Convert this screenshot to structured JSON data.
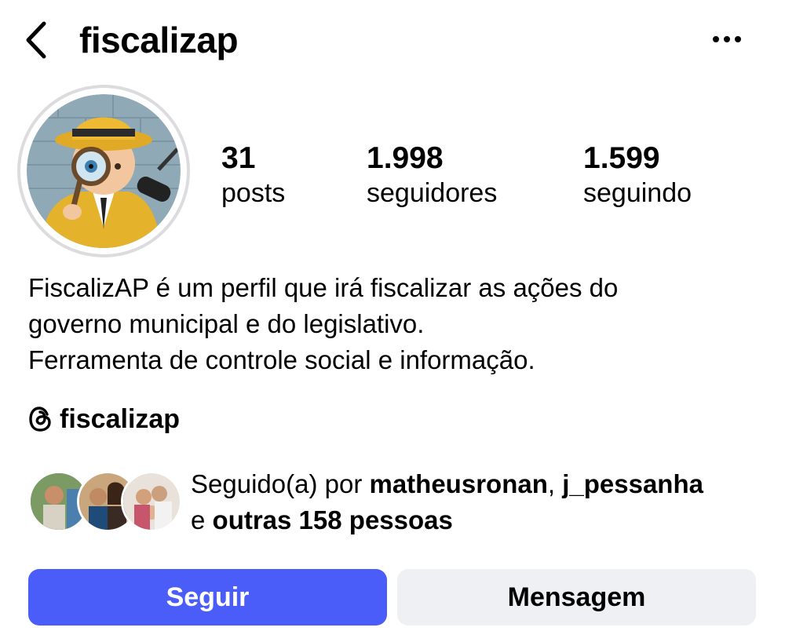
{
  "header": {
    "username": "fiscalizap",
    "back_icon": "chevron-left-icon",
    "more_icon": "more-horizontal-icon"
  },
  "stats": {
    "posts": {
      "value": "31",
      "label": "posts"
    },
    "followers": {
      "value": "1.998",
      "label": "seguidores"
    },
    "following": {
      "value": "1.599",
      "label": "seguindo"
    }
  },
  "bio": {
    "lines": [
      "FiscalizAP é um perfil que irá fiscalizar as ações do",
      "governo municipal e do legislativo.",
      "Ferramenta de controle social e informação."
    ]
  },
  "threads": {
    "icon": "threads-icon",
    "handle": "fiscalizap"
  },
  "followed_by": {
    "prefix": "Seguido(a) por ",
    "user1": "matheusronan",
    "separator": ", ",
    "user2": "j_pessanha",
    "connector": "e ",
    "others": "outras 158 pessoas"
  },
  "actions": {
    "follow_label": "Seguir",
    "message_label": "Mensagem"
  },
  "colors": {
    "follow_button": "#4a5df9",
    "message_button": "#eff0f3",
    "avatar_ring": "#dcdcdf"
  }
}
